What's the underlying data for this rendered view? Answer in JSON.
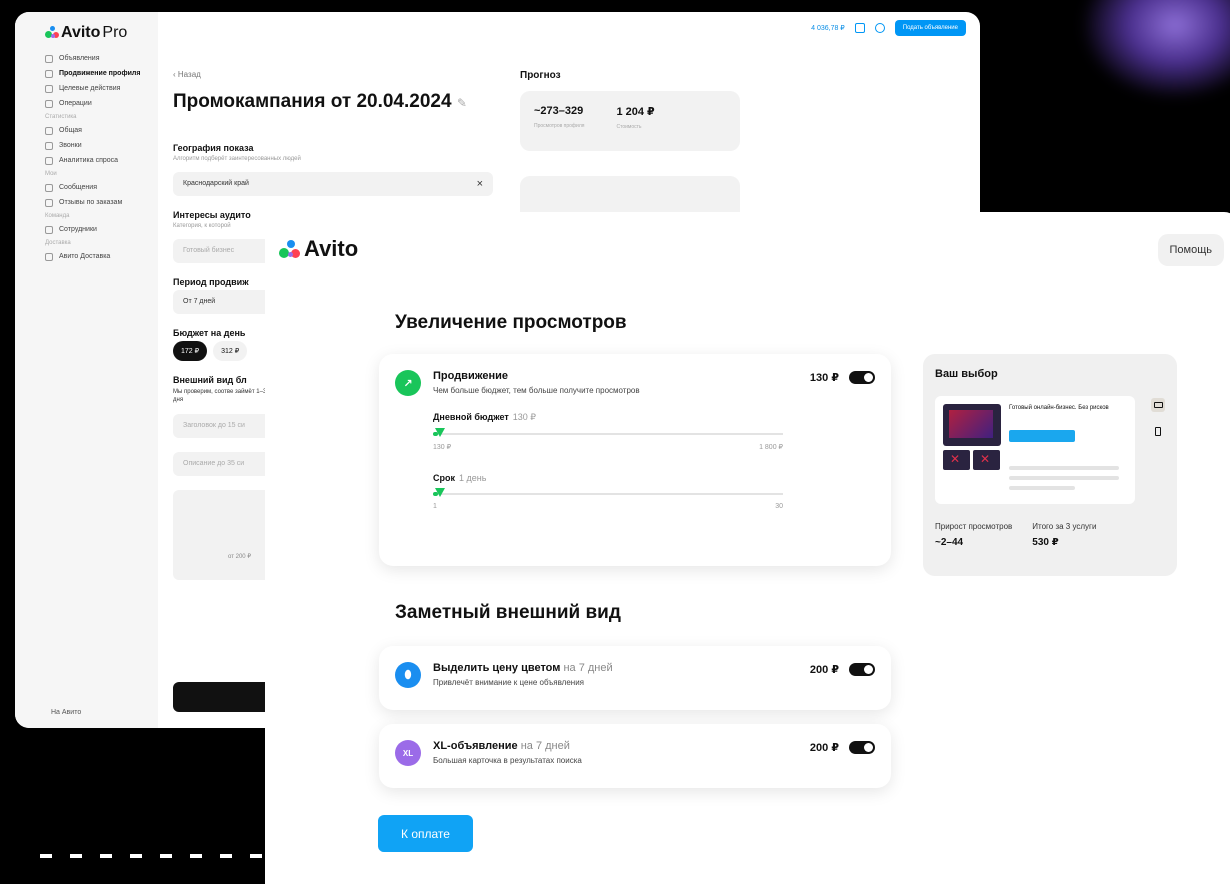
{
  "colors": {
    "accent": "#0096f5",
    "green": "#19c55a",
    "purple": "#9b6be8",
    "pay_button": "#10a3f5"
  },
  "pro": {
    "logo_bold": "Avito",
    "logo_light": " Pro",
    "nav": [
      {
        "label": "Объявления",
        "icon": "listings-icon"
      },
      {
        "label": "Продвижение профиля",
        "icon": "promotion-icon",
        "active": true
      },
      {
        "label": "Целевые действия",
        "icon": "target-icon"
      },
      {
        "label": "Операции",
        "icon": "operations-icon"
      }
    ],
    "section_stats": "Статистика",
    "nav_stats": [
      {
        "label": "Общая",
        "icon": "chart-icon"
      },
      {
        "label": "Звонки",
        "icon": "phone-icon"
      },
      {
        "label": "Аналитика спроса",
        "icon": "analytics-icon"
      }
    ],
    "section_work": "Мои",
    "nav_work": [
      {
        "label": "Сообщения",
        "icon": "messages-icon"
      },
      {
        "label": "Отзывы по заказам",
        "icon": "reviews-icon"
      }
    ],
    "section_team": "Команда",
    "nav_team": [
      {
        "label": "Сотрудники",
        "icon": "team-icon"
      }
    ],
    "section_delivery": "Доставка",
    "nav_delivery": [
      {
        "label": "Авито Доставка",
        "icon": "delivery-icon"
      }
    ],
    "footer": "На Авито",
    "balance": "4 036,78 ₽",
    "post_button": "Подать объявление",
    "back": "‹ Назад",
    "title": "Промокампания от 20.04.2024",
    "geo_label": "География показа",
    "geo_hint": "Алгоритм подберёт заинтересованных людей",
    "geo_value": "Краснодарский край",
    "interests_label": "Интересы аудито",
    "interests_hint": "Категория, к которой",
    "interests_placeholder": "Готовый бизнес",
    "period_label": "Период продвиж",
    "period_value": "От 7 дней",
    "budget_label": "Бюджет на день",
    "budget_pills": [
      "172 ₽",
      "312 ₽"
    ],
    "look_label": "Внешний вид бл",
    "look_desc": "Мы проверим, соотве займёт 1–3 дня",
    "field1": "Заголовок до 15 си",
    "field2": "Описание до 35 си",
    "box_note": "от 200 ₽",
    "forecast_title": "Прогноз",
    "forecast_views": "~273–329",
    "forecast_views_cap": "Просмотров профиля",
    "forecast_cost": "1 204 ₽",
    "forecast_cost_cap": "Стоимость"
  },
  "avito": {
    "logo": "Avito",
    "help": "Помощь",
    "section1_title": "Увеличение просмотров",
    "promo": {
      "title": "Продвижение",
      "subtitle": "Чем больше бюджет, тем больше получите просмотров",
      "price": "130 ₽",
      "icon": "arrow-up-right-icon",
      "budget_label": "Дневной бюджет",
      "budget_value": "130 ₽",
      "budget_min": "130 ₽",
      "budget_max": "1 800 ₽",
      "budget_fraction": 0.01,
      "term_label": "Срок",
      "term_value": "1 день",
      "term_min": "1",
      "term_max": "30",
      "term_fraction": 0.01
    },
    "section2_title": "Заметный внешний вид",
    "highlight": {
      "title": "Выделить цену цветом",
      "title_muted": "на 7 дней",
      "subtitle": "Привлечёт внимание к цене объявления",
      "price": "200 ₽",
      "icon": "tag-icon"
    },
    "xl": {
      "title": "XL-объявление",
      "title_muted": "на 7 дней",
      "subtitle": "Большая карточка в результатах поиска",
      "price": "200 ₽",
      "icon_text": "XL"
    },
    "choice": {
      "title": "Ваш выбор",
      "preview_title": "Готовый онлайн-бизнес. Без рисков",
      "growth_label": "Прирост просмотров",
      "growth_value": "~2–44",
      "total_label": "Итого за 3 услуги",
      "total_value": "530 ₽"
    },
    "pay_button": "К оплате"
  }
}
